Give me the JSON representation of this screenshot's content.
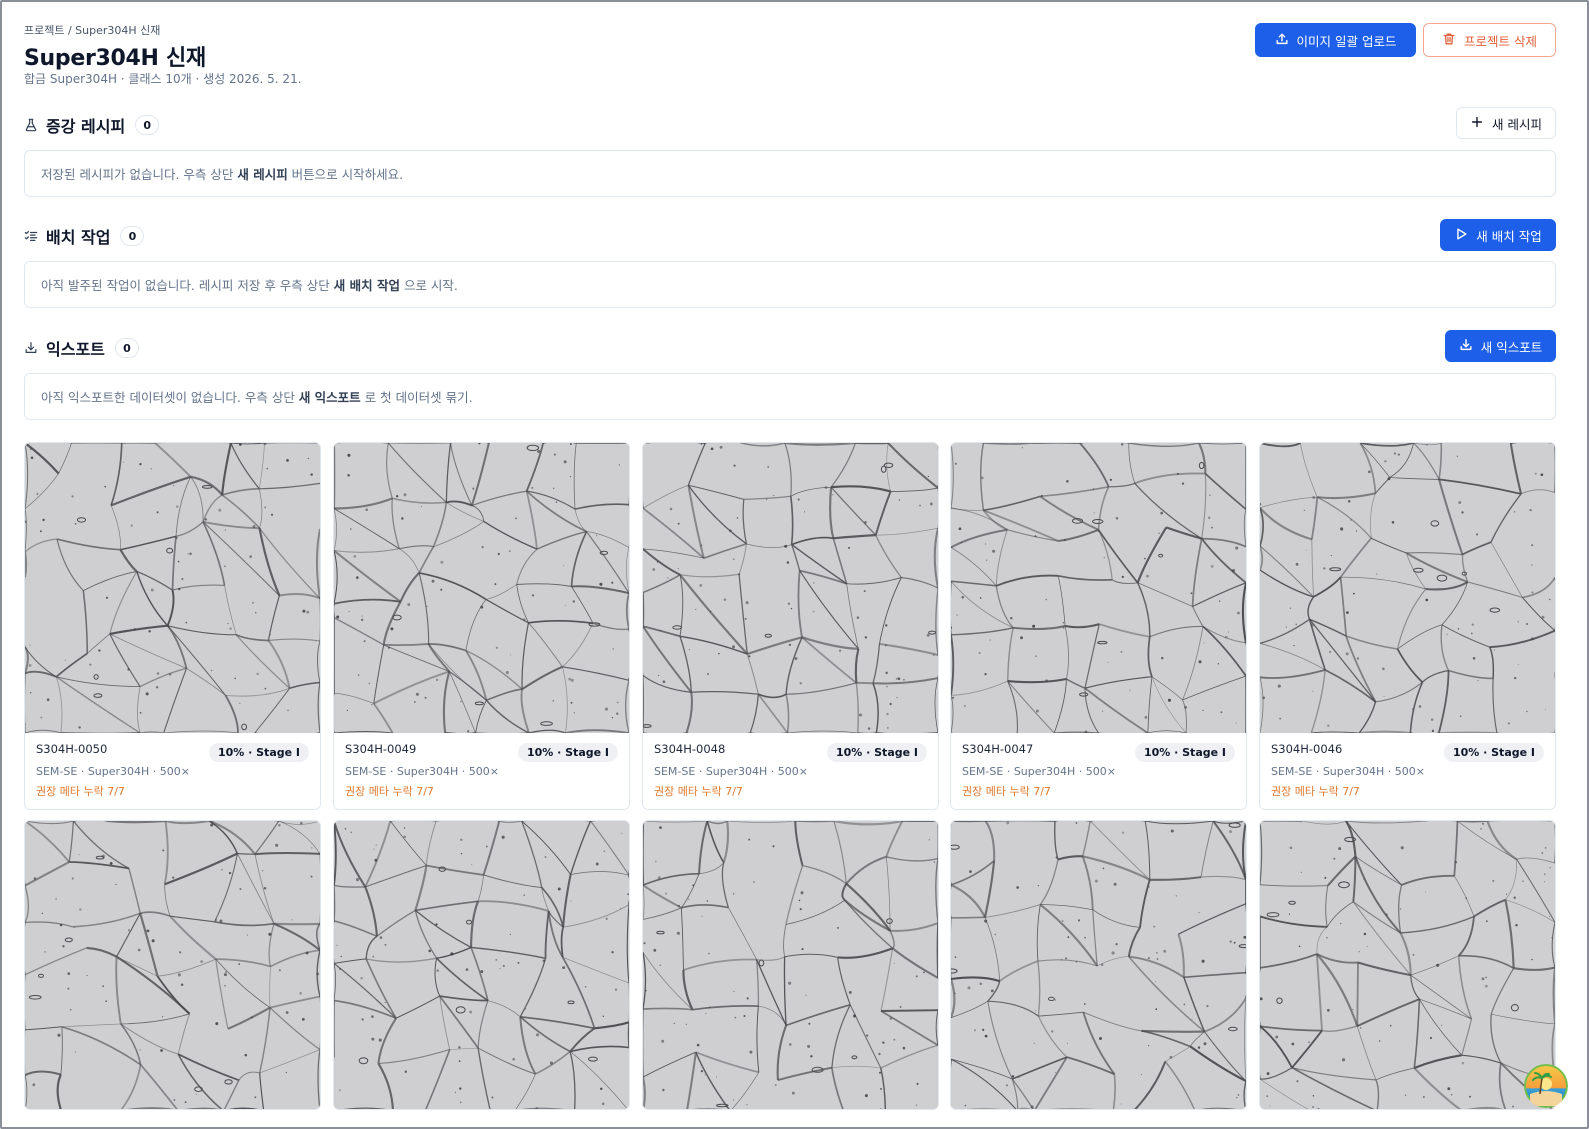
{
  "header": {
    "breadcrumb": "프로젝트 / Super304H 신재",
    "title": "Super304H 신재",
    "subtitle": "합금 Super304H · 클래스 10개 · 생성 2026. 5. 21.",
    "upload_label": "이미지 일괄 업로드",
    "delete_label": "프로젝트 삭제"
  },
  "sections": {
    "recipes": {
      "title": "증강 레시피",
      "count": "0",
      "action_label": "새 레시피",
      "empty_pre": "저장된 레시피가 없습니다. 우측 상단 ",
      "empty_bold": "새 레시피",
      "empty_post": " 버튼으로 시작하세요."
    },
    "batches": {
      "title": "배치 작업",
      "count": "0",
      "action_label": "새 배치 작업",
      "empty_pre": "아직 발주된 작업이 없습니다. 레시피 저장 후 우측 상단 ",
      "empty_bold": "새 배치 작업",
      "empty_post": " 으로 시작."
    },
    "exports": {
      "title": "익스포트",
      "count": "0",
      "action_label": "새 익스포트",
      "empty_pre": "아직 익스포트한 데이터셋이 없습니다. 우측 상단 ",
      "empty_bold": "새 익스포트",
      "empty_post": " 로 첫 데이터셋 묶기."
    }
  },
  "images": [
    {
      "id": "S304H-0050",
      "badge": "10% · Stage I",
      "meta": "SEM-SE · Super304H · 500×",
      "warning": "권장 메타 누락 7/7"
    },
    {
      "id": "S304H-0049",
      "badge": "10% · Stage I",
      "meta": "SEM-SE · Super304H · 500×",
      "warning": "권장 메타 누락 7/7"
    },
    {
      "id": "S304H-0048",
      "badge": "10% · Stage I",
      "meta": "SEM-SE · Super304H · 500×",
      "warning": "권장 메타 누락 7/7"
    },
    {
      "id": "S304H-0047",
      "badge": "10% · Stage I",
      "meta": "SEM-SE · Super304H · 500×",
      "warning": "권장 메타 누락 7/7"
    },
    {
      "id": "S304H-0046",
      "badge": "10% · Stage I",
      "meta": "SEM-SE · Super304H · 500×",
      "warning": "권장 메타 누락 7/7"
    }
  ],
  "colors": {
    "primary": "#1d5fe8",
    "danger": "#e0613b",
    "warning_text": "#e0792e",
    "micrograph_bg": "#cfcfd1",
    "grain_boundary": "#4a4a4e"
  }
}
